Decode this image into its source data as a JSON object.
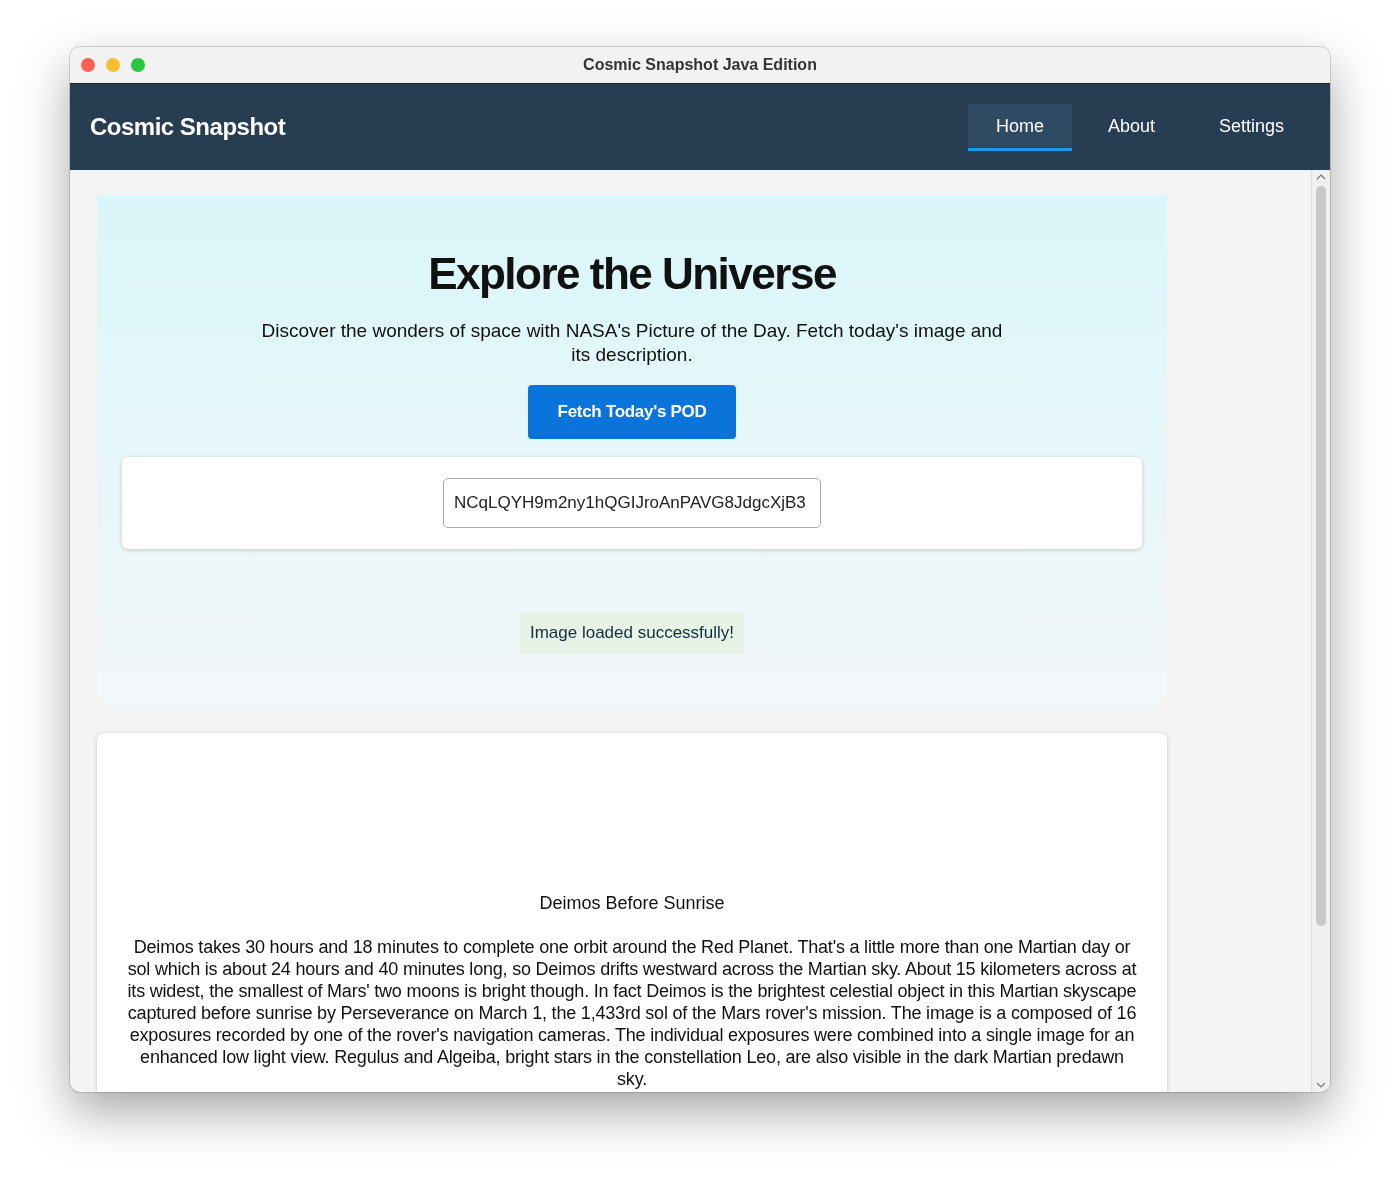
{
  "window": {
    "title": "Cosmic Snapshot Java Edition"
  },
  "navbar": {
    "brand": "Cosmic Snapshot",
    "tabs": [
      {
        "label": "Home",
        "selected": true
      },
      {
        "label": "About",
        "selected": false
      },
      {
        "label": "Settings",
        "selected": false
      }
    ]
  },
  "hero": {
    "heading": "Explore the Universe",
    "description": "Discover the wonders of space with NASA's Picture of the Day. Fetch today's image and its description.",
    "button": "Fetch Today's POD",
    "api_key_field": {
      "value": "NCqLQYH9m2ny1hQGIJroAnPAVG8JdgcXjB3"
    },
    "status": "Image loaded successfully!"
  },
  "picture": {
    "title": "Deimos Before Sunrise",
    "explanation": "Deimos takes 30 hours and 18 minutes to complete one orbit around the Red Planet. That's a little more than one Martian day or sol which is about 24 hours and 40 minutes long, so Deimos drifts westward across the Martian sky. About 15 kilometers across at its widest, the smallest of Mars' two moons is bright though. In fact Deimos is the brightest celestial object in this Martian skyscape captured before sunrise by Perseverance on March 1, the 1,433rd sol of the Mars rover's mission. The image is a composed of 16 exposures recorded by one of the rover's navigation cameras. The individual exposures were combined into a single image for an enhanced low light view. Regulus and Algeiba, bright stars in the constellation Leo, are also visible in the dark Martian predawn sky."
  }
}
